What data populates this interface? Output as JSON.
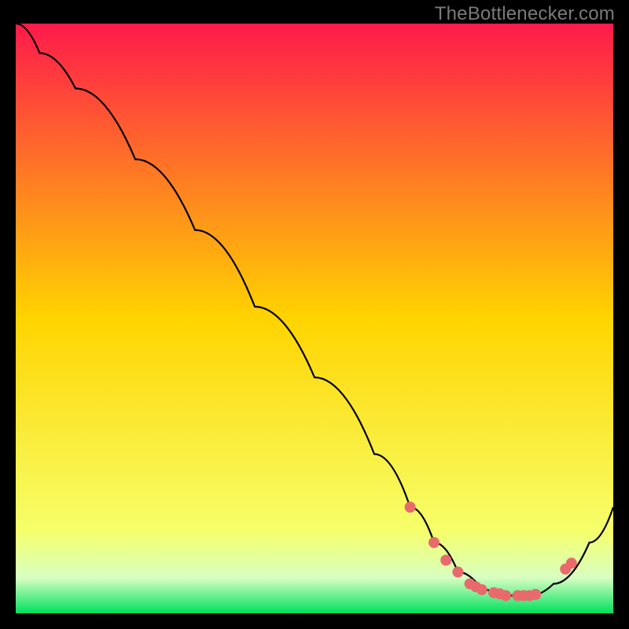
{
  "attribution": "TheBottlenecker.com",
  "colors": {
    "top": "#ff1a4b",
    "mid": "#ffd400",
    "low": "#f6ff6a",
    "pale": "#d8ffc2",
    "green": "#00e05e",
    "frame": "#000000",
    "curve": "#000000",
    "marker": "#e96a6d"
  },
  "chart_data": {
    "type": "line",
    "title": "",
    "xlabel": "",
    "ylabel": "",
    "xlim": [
      0,
      100
    ],
    "ylim": [
      0,
      100
    ],
    "series": [
      {
        "name": "curve",
        "x": [
          0,
          4,
          10,
          20,
          30,
          40,
          50,
          60,
          66,
          70,
          74,
          78,
          82,
          86,
          90,
          96,
          100
        ],
        "y": [
          100,
          95,
          89,
          77,
          65,
          52,
          40,
          27,
          18,
          12,
          7,
          4,
          3,
          3,
          5,
          12,
          18
        ]
      }
    ],
    "markers": {
      "name": "dots",
      "x": [
        66,
        70,
        72,
        74,
        76,
        77,
        78,
        80,
        81,
        82,
        84,
        85,
        86,
        87,
        92,
        93
      ],
      "y": [
        18,
        12,
        9,
        7,
        5,
        4.5,
        4,
        3.5,
        3.3,
        3,
        3,
        3,
        3,
        3.2,
        7.5,
        8.5
      ]
    }
  }
}
